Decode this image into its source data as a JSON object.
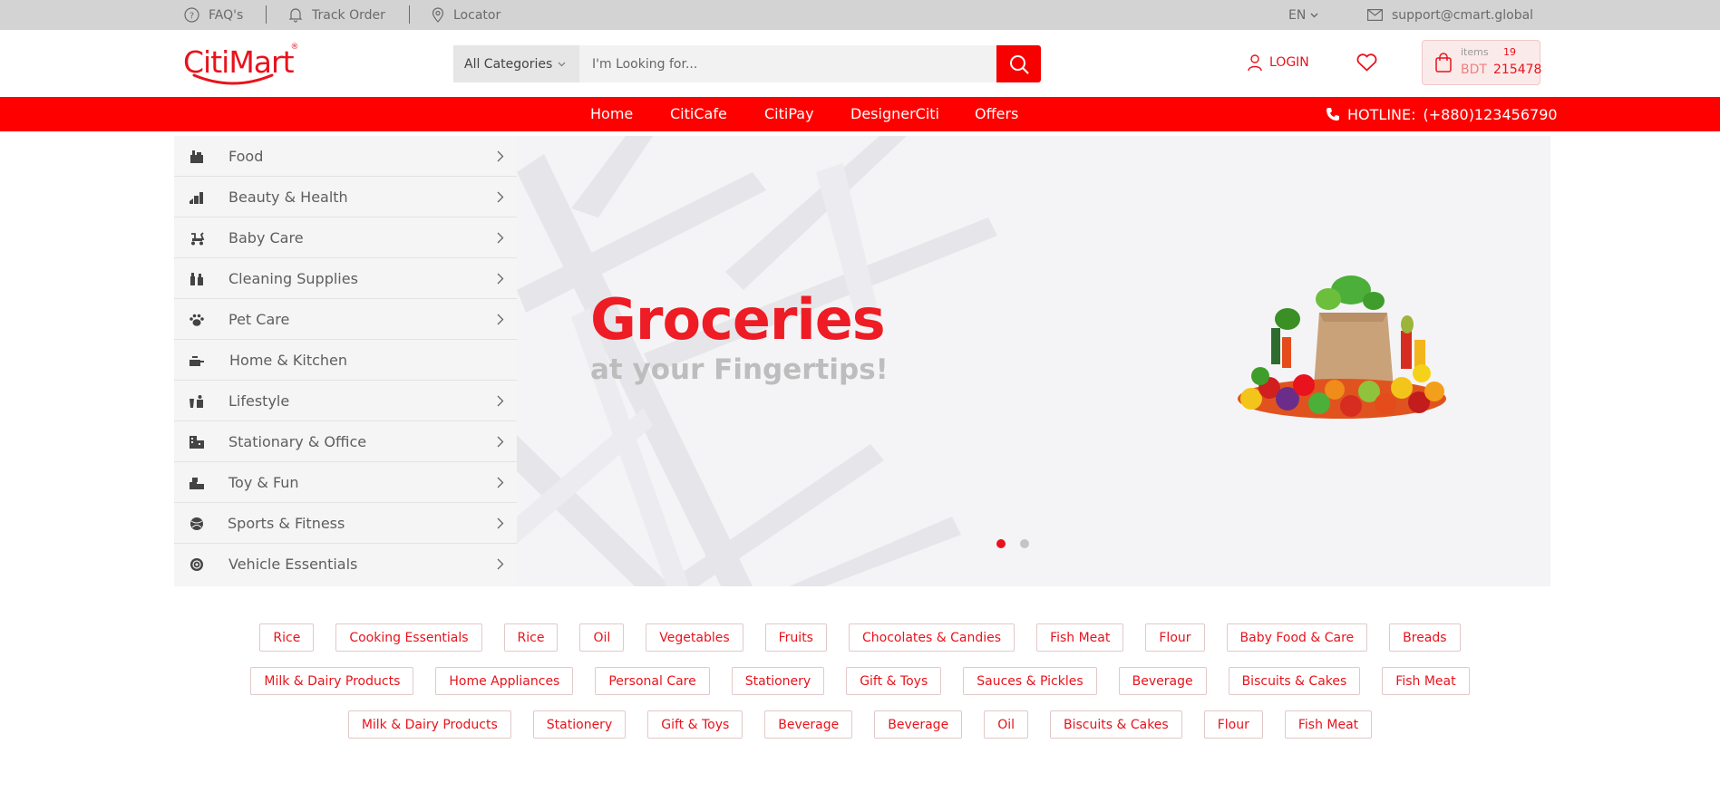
{
  "topbar": {
    "faq": "FAQ's",
    "track_order": "Track Order",
    "locator": "Locator",
    "language": "EN",
    "email": "support@cmart.global"
  },
  "header": {
    "logo_text": "CitiMart",
    "logo_reg": "®",
    "search_category": "All Categories",
    "search_placeholder": "I'm Looking for...",
    "login": "LOGIN",
    "cart": {
      "items_label": "items",
      "items_count": "19",
      "currency": "BDT",
      "total": "215478"
    }
  },
  "nav": {
    "links": [
      "Home",
      "CitiCafe",
      "CitiPay",
      "DesignerCiti",
      "Offers"
    ],
    "hotline_label": "HOTLINE:",
    "hotline_number": "(+880)123456790"
  },
  "categories": [
    {
      "label": "Food",
      "icon": "food-icon",
      "has_children": true
    },
    {
      "label": "Beauty & Health",
      "icon": "beauty-icon",
      "has_children": true
    },
    {
      "label": "Baby Care",
      "icon": "stroller-icon",
      "has_children": true
    },
    {
      "label": "Cleaning Supplies",
      "icon": "cleaning-icon",
      "has_children": true
    },
    {
      "label": "Pet Care",
      "icon": "paw-icon",
      "has_children": true
    },
    {
      "label": "Home & Kitchen",
      "icon": "kitchen-icon",
      "has_children": false
    },
    {
      "label": "Lifestyle",
      "icon": "lifestyle-icon",
      "has_children": true
    },
    {
      "label": "Stationary & Office",
      "icon": "office-icon",
      "has_children": true
    },
    {
      "label": "Toy & Fun",
      "icon": "toy-icon",
      "has_children": true
    },
    {
      "label": "Sports & Fitness",
      "icon": "ball-icon",
      "has_children": true
    },
    {
      "label": "Vehicle Essentials",
      "icon": "wheel-icon",
      "has_children": true
    }
  ],
  "banner": {
    "headline": "Groceries",
    "subline": "at your Fingertips!",
    "active_slide": 1,
    "slide_count": 2
  },
  "tag_rows": [
    [
      "Rice",
      "Cooking Essentials",
      "Rice",
      "Oil",
      "Vegetables",
      "Fruits",
      "Chocolates & Candies",
      "Fish Meat",
      "Flour",
      "Baby Food & Care",
      "Breads"
    ],
    [
      "Milk & Dairy Products",
      "Home Appliances",
      "Personal Care",
      "Stationery",
      "Gift & Toys",
      "Sauces & Pickles",
      "Beverage",
      "Biscuits & Cakes",
      "Fish Meat"
    ],
    [
      "Milk & Dairy Products",
      "Stationery",
      "Gift & Toys",
      "Beverage",
      "Beverage",
      "Oil",
      "Biscuits & Cakes",
      "Flour",
      "Fish Meat"
    ]
  ],
  "colors": {
    "brand_red": "#ff0000",
    "topbar_gray": "#d3d3d3",
    "sidebar_bg": "#f5f5f5"
  }
}
